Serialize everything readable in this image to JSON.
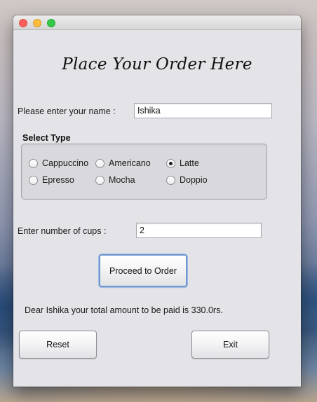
{
  "window": {
    "heading": "Place Your Order Here"
  },
  "name_field": {
    "label": "Please enter your name :",
    "value": "Ishika"
  },
  "type_group": {
    "title": "Select Type",
    "options": [
      {
        "label": "Cappuccino",
        "selected": false
      },
      {
        "label": "Americano",
        "selected": false
      },
      {
        "label": "Latte",
        "selected": true
      },
      {
        "label": "Epresso",
        "selected": false
      },
      {
        "label": "Mocha",
        "selected": false
      },
      {
        "label": "Doppio",
        "selected": false
      }
    ]
  },
  "cups_field": {
    "label": "Enter number of cups :",
    "value": "2"
  },
  "buttons": {
    "proceed": "Proceed to Order",
    "reset": "Reset",
    "exit": "Exit"
  },
  "result": {
    "message": "Dear Ishika your total amount to be paid is 330.0rs."
  }
}
